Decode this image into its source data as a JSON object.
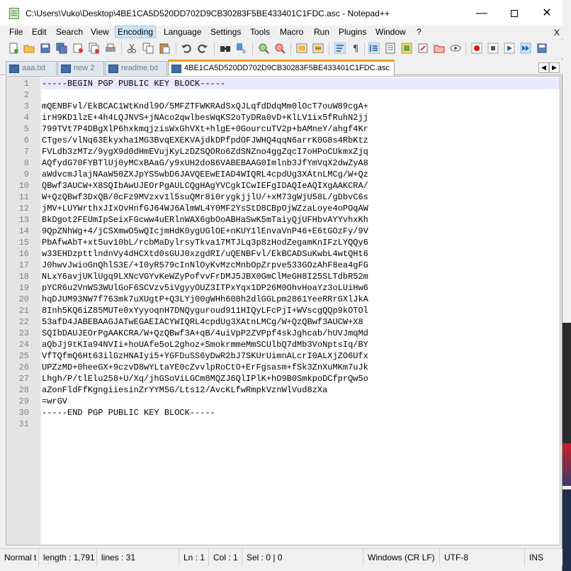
{
  "window": {
    "title": "C:\\Users\\Vuko\\Desktop\\4BE1CA5D520DD702D9CB30283F5BE433401C1FDC.asc - Notepad++",
    "minimize": "—",
    "close": "✕"
  },
  "menu": {
    "items": [
      "File",
      "Edit",
      "Search",
      "View",
      "Encoding",
      "Language",
      "Settings",
      "Tools",
      "Macro",
      "Run",
      "Plugins",
      "Window",
      "?"
    ],
    "close_x": "X"
  },
  "toolbar": {
    "icons": [
      "new-file-icon",
      "open-file-icon",
      "save-icon",
      "save-all-icon",
      "close-icon",
      "close-all-icon",
      "print-icon",
      "cut-icon",
      "copy-icon",
      "paste-icon",
      "undo-icon",
      "redo-icon",
      "find-icon",
      "replace-icon",
      "zoom-in-icon",
      "zoom-out-icon",
      "sync-vertical-icon",
      "sync-horizontal-icon",
      "word-wrap-icon",
      "all-characters-icon",
      "indent-guide-icon",
      "document-map-icon",
      "function-list-icon",
      "folder-workspace-icon",
      "monitoring-icon",
      "record-macro-icon",
      "stop-record-icon",
      "play-macro-icon",
      "play-multiple-icon",
      "save-macro-icon"
    ]
  },
  "tabs": [
    {
      "label": "aaa.txt",
      "active": false
    },
    {
      "label": "new 2",
      "active": false
    },
    {
      "label": "readme.txt",
      "active": false
    },
    {
      "label": "4BE1CA5D520DD702D9CB30283F5BE433401C1FDC.asc",
      "active": true
    }
  ],
  "tab_nav": {
    "prev": "◀",
    "next": "▶"
  },
  "editor": {
    "current_line": 1,
    "lines": [
      "-----BEGIN PGP PUBLIC KEY BLOCK-----",
      "",
      "mQENBFvl/EkBCAC1WtKndl9O/5MFZTFWKRAdSxQJLqfdDdqMm0lOcT7ouW89cgA+",
      "irH9KD1lzE+4h4LQJNVS+jNAco2qwlbesWqKS2oTyDRa0vD+KlLV1ix5fRuhN2jj",
      "799TVt7P4DBgXlP6hxkmqjzisWxGhVXt+hlgE+0GourcuTV2p+bAMneY/ahgf4Kr",
      "CTges/vlNq63Ekyxha1MG3BvqEXEKVAjdkDPfpdOFJWHQ4qqN6arrK0G8s4RbKtz",
      "FVLdb3zMTz/9ygX9d0dHmEVujKyLzDZSQORo6ZdSNZno4ggZqcI7oHPoCUkmxZjq",
      "AQfydG70FYBTlUj0yMCxBAaG/y9xUH2do86VABEBAAG0Imlnb3JfYmVqX2dwZyA8",
      "aWdvcmJlajNAaW50ZXJpYS5wbD6JAVQEEwEIAD4WIQRL4cpdUg3XAtnLMCg/W+Qz",
      "QBwf3AUCW+X8SQIbAwUJEOrPgAULCQgHAgYVCgkICwIEFgIDAQIeAQIXgAAKCRA/",
      "W+QzQBwf3DxQB/0cFz9MVzxv1l5suQMr8i0rygkjjlU/+xM73gWjU58L/gDbvC6s",
      "jMV+LUYWrthxJIxOvHnfGJ64WJ6AlmWL4Y0MF2YsStD8CBpOjWZzaLoye4oPOqAW",
      "BkDgot2FEUmIpSeixFGcww4uERlnWAX6gbOoABHaSwK5mTaiyQjUFHbvAYYvhxKh",
      "9QpZNhWg+4/jCSXmwO5wQIcjmHdK0ygUGlOE+nKUY1lEnvaVnP46+E6tGOzFy/9V",
      "PbAfwAbT+xt5uv10bL/rcbMaDylrsyTkva17MTJLq3p8zHodZegamKnIFzLYQQy6",
      "w33EHDzpttlndnVy4dHCXtd0sGUJ0xzgdRI/uQENBFvl/EkBCADSuKwbL4wtQHt6",
      "J0hwvJwioGnQhlS3E/+I0yR579cInNlOyKvMzcMnbOpZrpve533GOzAhF8ea4gFG",
      "NLxY6avjUKlUgq9LXNcVGYvKeWZyPofvvFrDMJ5JBX0GmClMeGH8I25SLTdbR52m",
      "pYCR6u2VnWS3WUlGoF6SCVzv5iVgyyOUZ3ITPxYqx1DP26M0OhvHoaYz3oLUiHw6",
      "hqDJUM93NW7f763mk7uXUgtP+Q3LYj00gWHh608h2dlGGLpm2861YeeRRrGXlJkA",
      "8Inh5KQ6iZ85MUTe0xYyyoqnH7DNQyguroud911HIQyLFcPjI+WVscgQQp9kOTOl",
      "53afD4JABEBAAGJATwEGAEIACYWIQRL4cpdUg3XAtnLMCg/W+QzQBwf3AUCW+X8",
      "SQIbDAUJEOrPgAAKCRA/W+QzQBwf3A+qB/4uiVpP2ZVPpf4skJghcab/hUVJmqMd",
      "aQbJj9tKIa94NVIi+hoUAfe5oL2ghoz+SmokrmmeMmSCUlbQ7dMb3VoNptsIq/BY",
      "VfTQfmQ6Ht63ilGzHNAIyi5+YGFDuSS6yDwR2bJ7SKUrUimnALcrI0ALXjZO6Ufx",
      "UPZzMD+0heeGX+9czvD8wYLtaYE0cZvvlpRoCtO+ErFgsasm+fSk3ZnXuMKm7uJk",
      "Lhgh/P/tlElu258+U/Xq/jhGSoViLGCm8MQZJ6QlIPlK+hO9B0SmkpoDCfprQw5o",
      "aZonFldFfKgngiiesinZrYYM5G/Lts12/AvcKLfwRmpkVznWlVud8zXa",
      "=wrGV",
      "-----END PGP PUBLIC KEY BLOCK-----",
      ""
    ]
  },
  "status": {
    "file_type": "Normal t",
    "length": "length : 1,791",
    "lines": "lines : 31",
    "ln": "Ln : 1",
    "col": "Col : 1",
    "sel": "Sel : 0 | 0",
    "eol": "Windows (CR LF)",
    "encoding": "UTF-8",
    "ins": "INS"
  }
}
